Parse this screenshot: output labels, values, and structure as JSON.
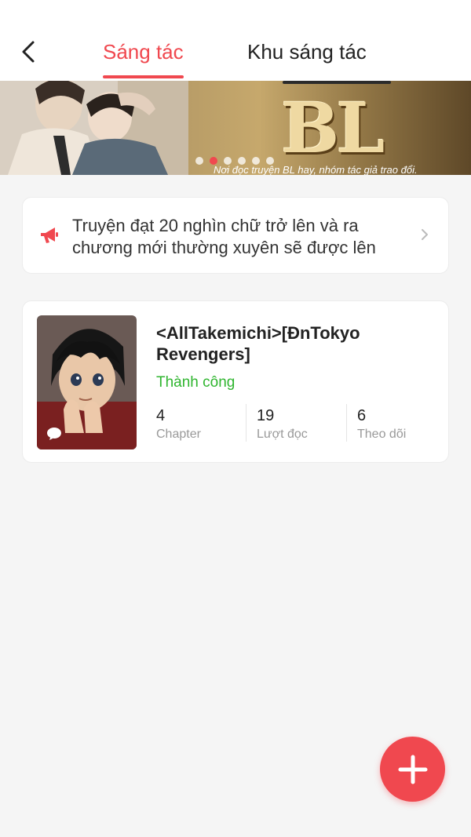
{
  "header": {
    "tabs": [
      {
        "label": "Sáng tác",
        "active": true
      },
      {
        "label": "Khu sáng tác",
        "active": false
      }
    ],
    "back_icon": "chevron-left-icon"
  },
  "banner": {
    "logo_text": "BL",
    "caption": "Nơi đọc truyện BL hay, nhóm tác giả trao đổi.",
    "slide_count": 6,
    "active_slide": 2
  },
  "notice": {
    "icon": "megaphone-icon",
    "text": "Truyện đạt 20 nghìn chữ trở lên và ra chương mới thường xuyên sẽ được lên"
  },
  "story": {
    "title": "<AllTakemichi>[ĐnTokyo Revengers]",
    "status": "Thành công",
    "stats": [
      {
        "value": "4",
        "label": "Chapter"
      },
      {
        "value": "19",
        "label": "Lượt đọc"
      },
      {
        "value": "6",
        "label": "Theo dõi"
      }
    ]
  },
  "fab": {
    "icon": "plus-icon"
  },
  "colors": {
    "accent": "#f0484f",
    "success": "#2fb52f",
    "background": "#f5f5f5"
  }
}
